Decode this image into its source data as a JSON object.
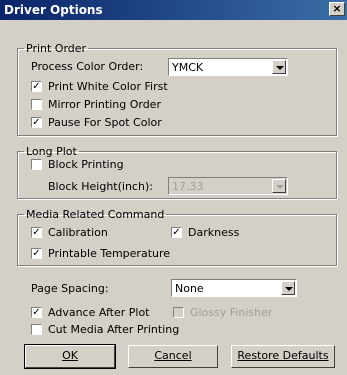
{
  "window": {
    "title": "Driver Options",
    "close_glyph": "×"
  },
  "print_order": {
    "legend": "Print Order",
    "process_color_order_label": "Process Color Order:",
    "process_color_order_value": "YMCK",
    "print_white_first": {
      "label": "Print White Color First",
      "checked": true
    },
    "mirror_printing": {
      "label": "Mirror Printing Order",
      "checked": false
    },
    "pause_spot": {
      "label": "Pause For Spot Color",
      "checked": true
    }
  },
  "long_plot": {
    "legend": "Long Plot",
    "block_printing": {
      "label": "Block Printing",
      "checked": false
    },
    "block_height_label": "Block Height(inch):",
    "block_height_value": "17.33"
  },
  "media_related": {
    "legend": "Media Related Command",
    "calibration": {
      "label": "Calibration",
      "checked": true
    },
    "darkness": {
      "label": "Darkness",
      "checked": true
    },
    "printable_temp": {
      "label": "Printable Temperature",
      "checked": true
    }
  },
  "page_spacing": {
    "label": "Page Spacing:",
    "value": "None"
  },
  "advance_after_plot": {
    "label": "Advance After Plot",
    "checked": true
  },
  "glossy_finisher": {
    "label": "Glossy Finisher",
    "checked": false
  },
  "cut_media": {
    "label": "Cut Media After Printing",
    "checked": false
  },
  "buttons": {
    "ok": "OK",
    "cancel": "Cancel",
    "restore": "Restore Defaults"
  },
  "check_glyph": "✓"
}
